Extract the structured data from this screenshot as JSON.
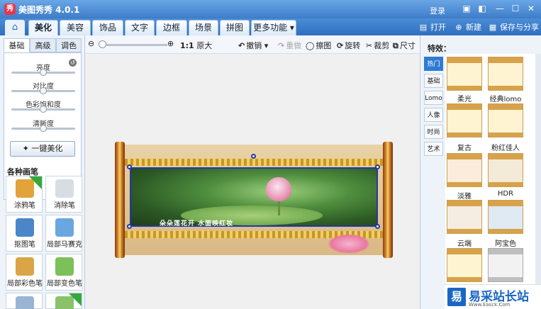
{
  "window": {
    "title": "美图秀秀 4.0.1",
    "logo_char": "秀",
    "login": "登录",
    "controls": [
      "chat-icon",
      "skin-icon",
      "minimize-icon",
      "maximize-icon",
      "close-icon"
    ]
  },
  "tabs": [
    "美化",
    "美容",
    "饰品",
    "文字",
    "边框",
    "场景",
    "拼图",
    "更多功能 ▾"
  ],
  "active_tab": "美化",
  "top_actions": {
    "open": "打开",
    "new": "新建",
    "save": "保存与分享"
  },
  "left": {
    "subtabs": [
      "基础",
      "高级",
      "调色"
    ],
    "sliders": [
      {
        "label": "亮度",
        "value": 0.5
      },
      {
        "label": "对比度",
        "value": 0.5
      },
      {
        "label": "色彩饱和度",
        "value": 0.5
      },
      {
        "label": "清晰度",
        "value": 0.5
      }
    ],
    "beautify": "一键美化",
    "brush_section": "各种画笔",
    "brushes": [
      {
        "label": "涂鸦笔",
        "color": "#e2a33a",
        "badge": "升级"
      },
      {
        "label": "消除笔",
        "color": "#d8dde4",
        "badge": ""
      },
      {
        "label": "抠图笔",
        "color": "#4a86c8",
        "badge": ""
      },
      {
        "label": "局部马赛克",
        "color": "#6aa7e0",
        "badge": ""
      },
      {
        "label": "局部彩色笔",
        "color": "#d9a546",
        "badge": ""
      },
      {
        "label": "局部变色笔",
        "color": "#7cc05a",
        "badge": ""
      },
      {
        "label": "",
        "color": "#9ab5d3",
        "badge": ""
      },
      {
        "label": "",
        "color": "#8ac26a",
        "badge": "new"
      }
    ]
  },
  "toolbar": {
    "zoom_value": 0.0,
    "ratio": "1:1",
    "original": "原大",
    "undo": "撤销",
    "redo": "重做",
    "erase": "擦图",
    "rotate": "旋转",
    "crop": "裁剪",
    "size": "尺寸"
  },
  "image": {
    "caption": "朵朵莲花开  水面映红妆"
  },
  "effects": {
    "title": "特效：",
    "categories": [
      "热门",
      "基础",
      "Lomo",
      "人像",
      "时尚",
      "艺术"
    ],
    "active_category": "热门",
    "items": [
      "柔光",
      "经典lomo",
      "复古",
      "粉红佳人",
      "淡雅",
      "HDR",
      "云端",
      "阿宝色"
    ]
  },
  "watermark": {
    "logo_char": "易",
    "text": "易采站长站",
    "sub": "Www.Easck.Com"
  }
}
